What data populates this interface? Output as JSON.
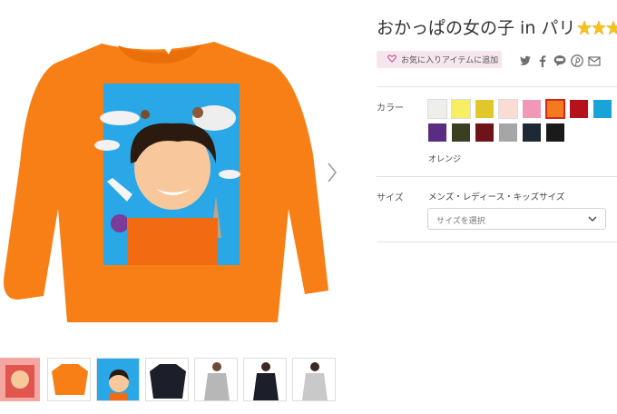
{
  "product": {
    "title": "おかっぱの女の子 in パリ",
    "favorite_label": "お気に入りアイテムに追加"
  },
  "share": [
    "twitter-icon",
    "facebook-icon",
    "line-icon",
    "pinterest-icon",
    "mail-icon"
  ],
  "color": {
    "label": "カラー",
    "selected_name": "オレンジ",
    "swatches": [
      "#eeeeea",
      "#f8ee64",
      "#e2c72c",
      "#fbdcd4",
      "#f197b8",
      "#f47a20",
      "#b5121b",
      "#1aa3d9",
      "#5a2d82",
      "#3b3f22",
      "#6e1418",
      "#a6a6a6",
      "#1f2836",
      "#1a1a1a"
    ],
    "selected_index": 5
  },
  "size": {
    "label": "サイズ",
    "heading": "メンズ・レディース・キッズサイズ",
    "placeholder": "サイズを選択"
  },
  "thumbnails": [
    "design-pink",
    "orange-tee",
    "design",
    "black-tee",
    "gray-tee-model",
    "black-tee-model",
    "gray-tee-model-2"
  ]
}
